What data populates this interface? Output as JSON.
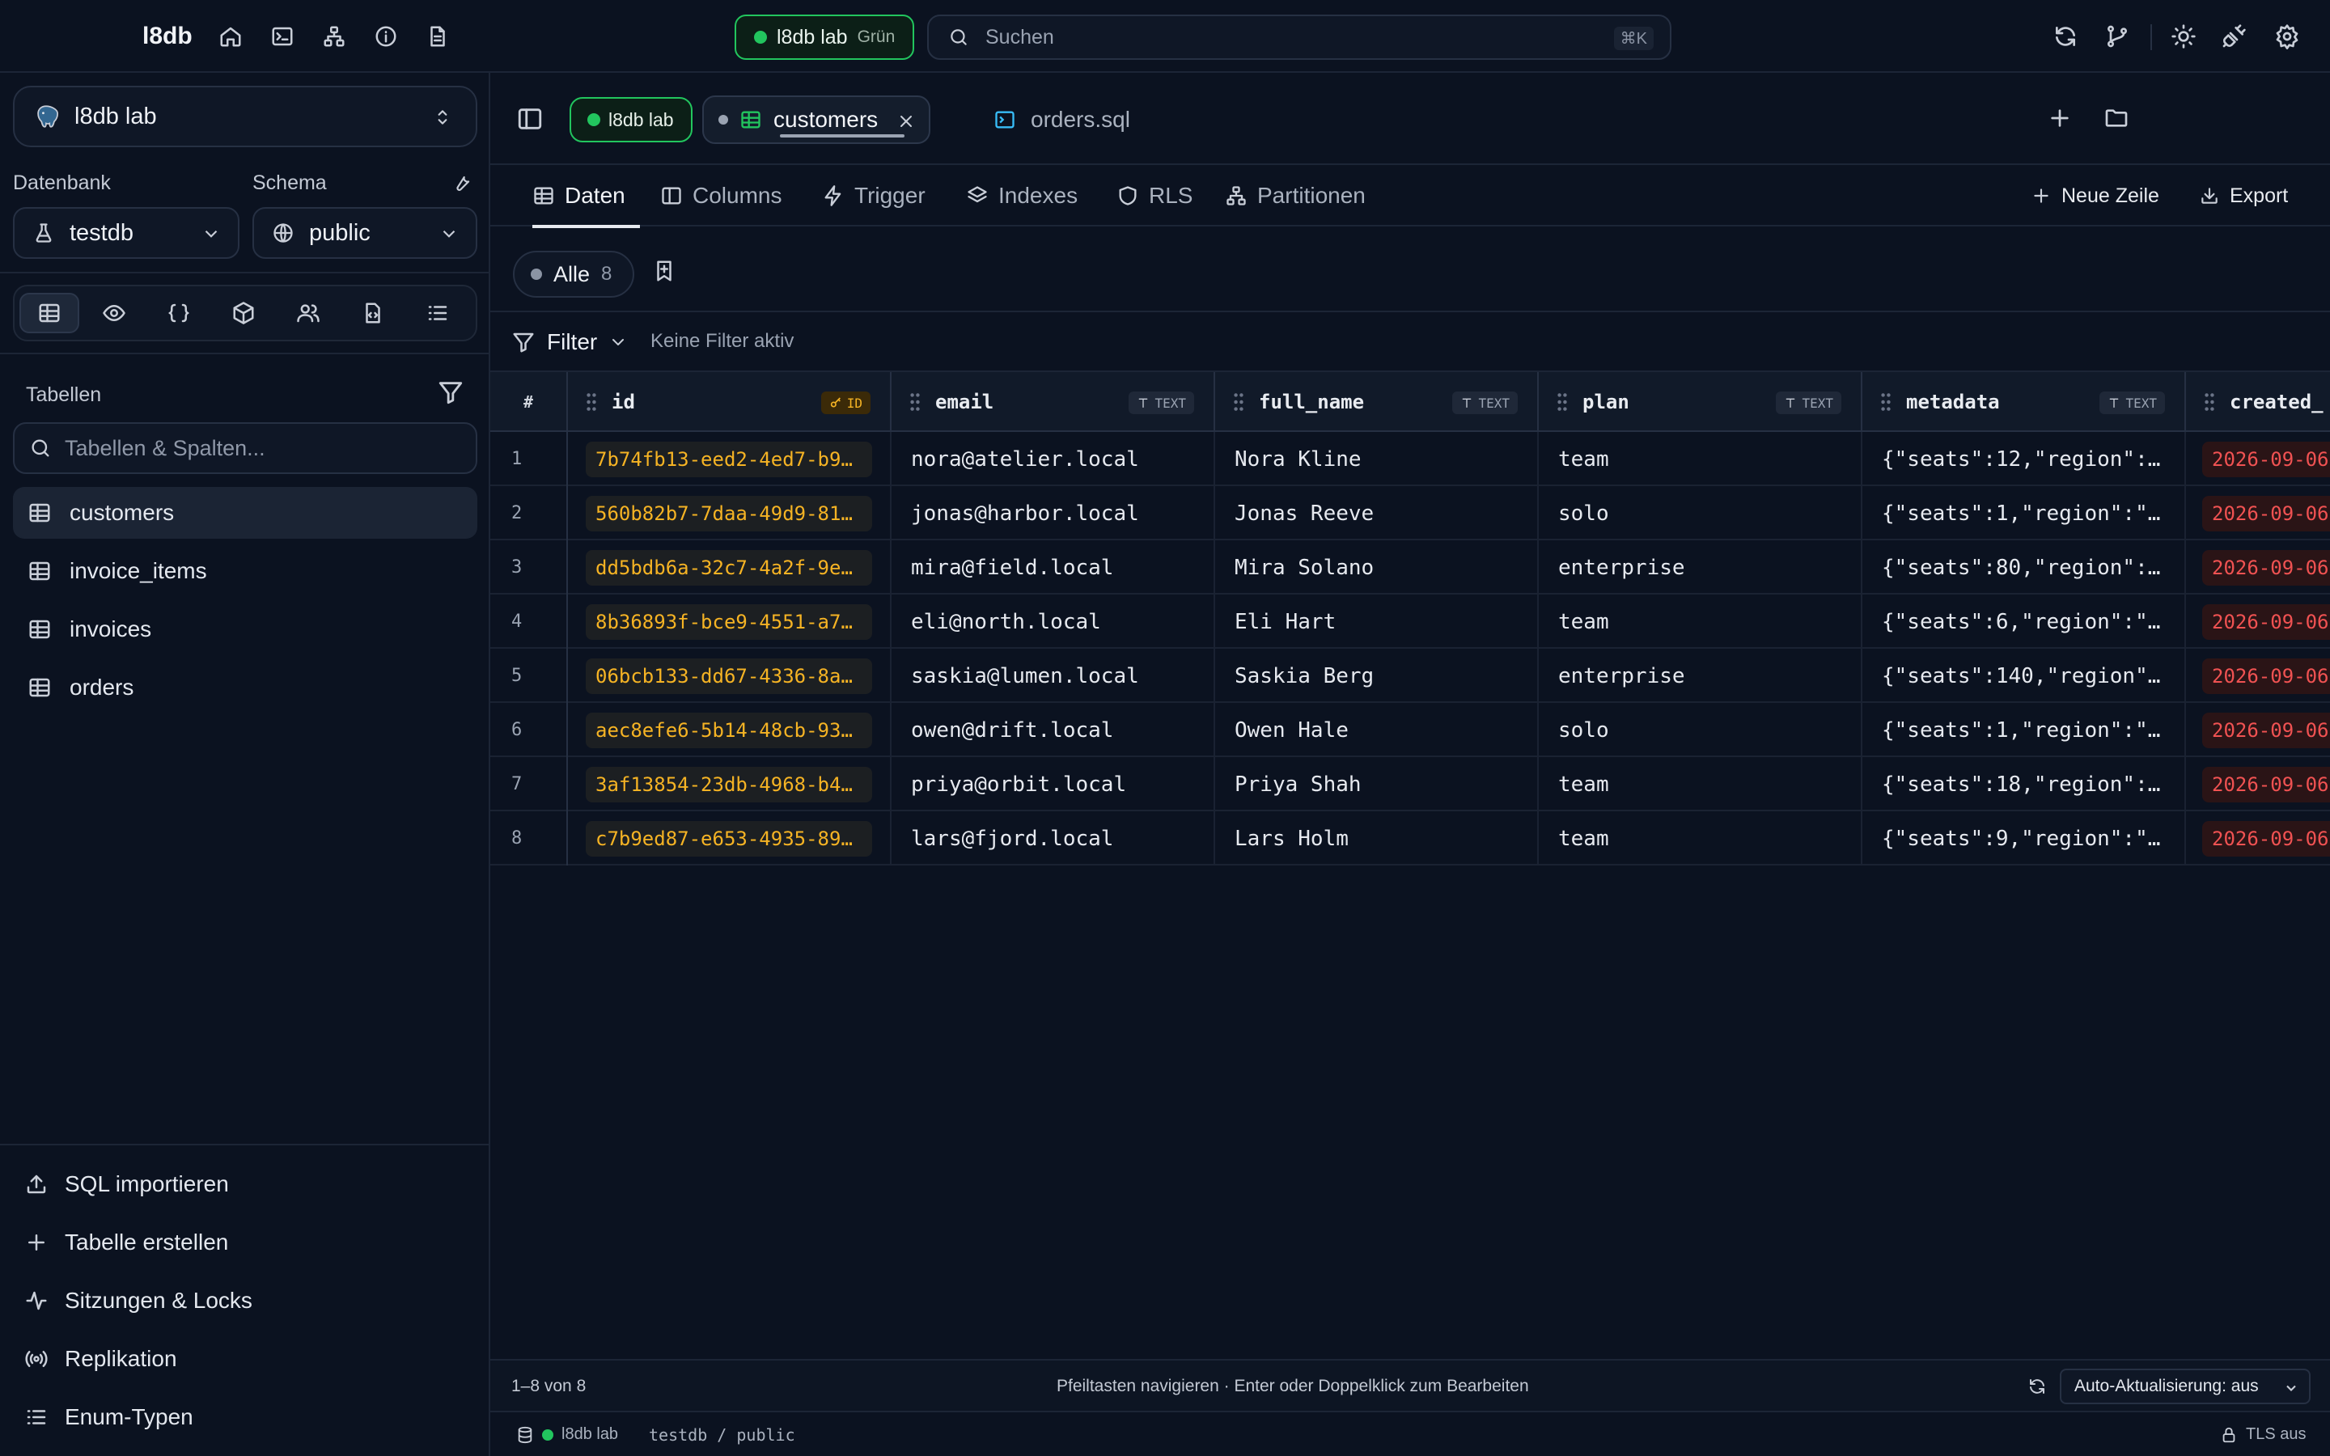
{
  "app": {
    "brand": "l8db"
  },
  "topbar": {
    "nav_icons": [
      "home-icon",
      "terminal-icon",
      "sitemap-icon",
      "info-icon",
      "document-icon"
    ],
    "connection": {
      "name": "l8db lab",
      "env": "Grün",
      "status_color": "#22c55e"
    },
    "search": {
      "placeholder": "Suchen",
      "shortcut": "⌘K"
    },
    "right_icons": [
      "refresh-icon",
      "git-branch-icon",
      "sun-icon",
      "plug-icon",
      "settings-icon"
    ]
  },
  "sidebar": {
    "connection_select": "l8db lab",
    "database_label": "Datenbank",
    "schema_label": "Schema",
    "database_value": "testdb",
    "schema_value": "public",
    "object_types": [
      "table-icon",
      "eye-icon",
      "braces-icon",
      "cube-icon",
      "users-icon",
      "code-file-icon",
      "list-icon"
    ],
    "tables_label": "Tabellen",
    "table_search_placeholder": "Tabellen & Spalten...",
    "tables": [
      {
        "name": "customers",
        "active": true
      },
      {
        "name": "invoice_items",
        "active": false
      },
      {
        "name": "invoices",
        "active": false
      },
      {
        "name": "orders",
        "active": false
      }
    ],
    "bottom_items": [
      {
        "label": "SQL importieren",
        "icon": "upload-icon"
      },
      {
        "label": "Tabelle erstellen",
        "icon": "plus-icon"
      },
      {
        "label": "Sitzungen & Locks",
        "icon": "activity-icon"
      },
      {
        "label": "Replikation",
        "icon": "broadcast-icon"
      },
      {
        "label": "Enum-Typen",
        "icon": "list-icon"
      }
    ]
  },
  "tabs": {
    "connection": "l8db lab",
    "active_tab": "customers",
    "sql_tab": "orders.sql"
  },
  "subtabs": {
    "items": [
      "Daten",
      "Columns",
      "Trigger",
      "Indexes",
      "RLS",
      "Partitionen"
    ],
    "active": "Daten",
    "new_row": "Neue Zeile",
    "export": "Export"
  },
  "views": {
    "all_label": "Alle",
    "all_count": "8"
  },
  "filter": {
    "label": "Filter",
    "status": "Keine Filter aktiv"
  },
  "grid": {
    "rownum_header": "#",
    "columns": [
      {
        "name": "id",
        "type": "ID"
      },
      {
        "name": "email",
        "type": "TEXT"
      },
      {
        "name": "full_name",
        "type": "TEXT"
      },
      {
        "name": "plan",
        "type": "TEXT"
      },
      {
        "name": "metadata",
        "type": "TEXT"
      },
      {
        "name": "created_",
        "type": ""
      }
    ],
    "rows": [
      {
        "n": "1",
        "id": "7b74fb13-eed2-4ed7-b95…",
        "email": "nora@atelier.local",
        "full_name": "Nora Kline",
        "plan": "team",
        "metadata": "{\"seats\":12,\"region\":…",
        "created": "2026-09-06"
      },
      {
        "n": "2",
        "id": "560b82b7-7daa-49d9-819…",
        "email": "jonas@harbor.local",
        "full_name": "Jonas Reeve",
        "plan": "solo",
        "metadata": "{\"seats\":1,\"region\":\"…",
        "created": "2026-09-06"
      },
      {
        "n": "3",
        "id": "dd5bdb6a-32c7-4a2f-9e0…",
        "email": "mira@field.local",
        "full_name": "Mira Solano",
        "plan": "enterprise",
        "metadata": "{\"seats\":80,\"region\":…",
        "created": "2026-09-06"
      },
      {
        "n": "4",
        "id": "8b36893f-bce9-4551-a72…",
        "email": "eli@north.local",
        "full_name": "Eli Hart",
        "plan": "team",
        "metadata": "{\"seats\":6,\"region\":\"…",
        "created": "2026-09-06"
      },
      {
        "n": "5",
        "id": "06bcb133-dd67-4336-8a0…",
        "email": "saskia@lumen.local",
        "full_name": "Saskia Berg",
        "plan": "enterprise",
        "metadata": "{\"seats\":140,\"region\"…",
        "created": "2026-09-06"
      },
      {
        "n": "6",
        "id": "aec8efe6-5b14-48cb-934…",
        "email": "owen@drift.local",
        "full_name": "Owen Hale",
        "plan": "solo",
        "metadata": "{\"seats\":1,\"region\":\"…",
        "created": "2026-09-06"
      },
      {
        "n": "7",
        "id": "3af13854-23db-4968-b4d…",
        "email": "priya@orbit.local",
        "full_name": "Priya Shah",
        "plan": "team",
        "metadata": "{\"seats\":18,\"region\":…",
        "created": "2026-09-06"
      },
      {
        "n": "8",
        "id": "c7b9ed87-e653-4935-890…",
        "email": "lars@fjord.local",
        "full_name": "Lars Holm",
        "plan": "team",
        "metadata": "{\"seats\":9,\"region\":\"…",
        "created": "2026-09-06"
      }
    ]
  },
  "footer": {
    "range": "1–8 von 8",
    "hint": "Pfeiltasten navigieren · Enter oder Doppelklick zum Bearbeiten",
    "autorefresh": "Auto-Aktualisierung: aus"
  },
  "statusbar": {
    "connection": "l8db lab",
    "path": "testdb / public",
    "tls": "TLS aus"
  },
  "colors": {
    "background": "#0b1220",
    "accent_green": "#22c55e",
    "id_accent": "#f5b324",
    "date_accent": "#f05252"
  }
}
